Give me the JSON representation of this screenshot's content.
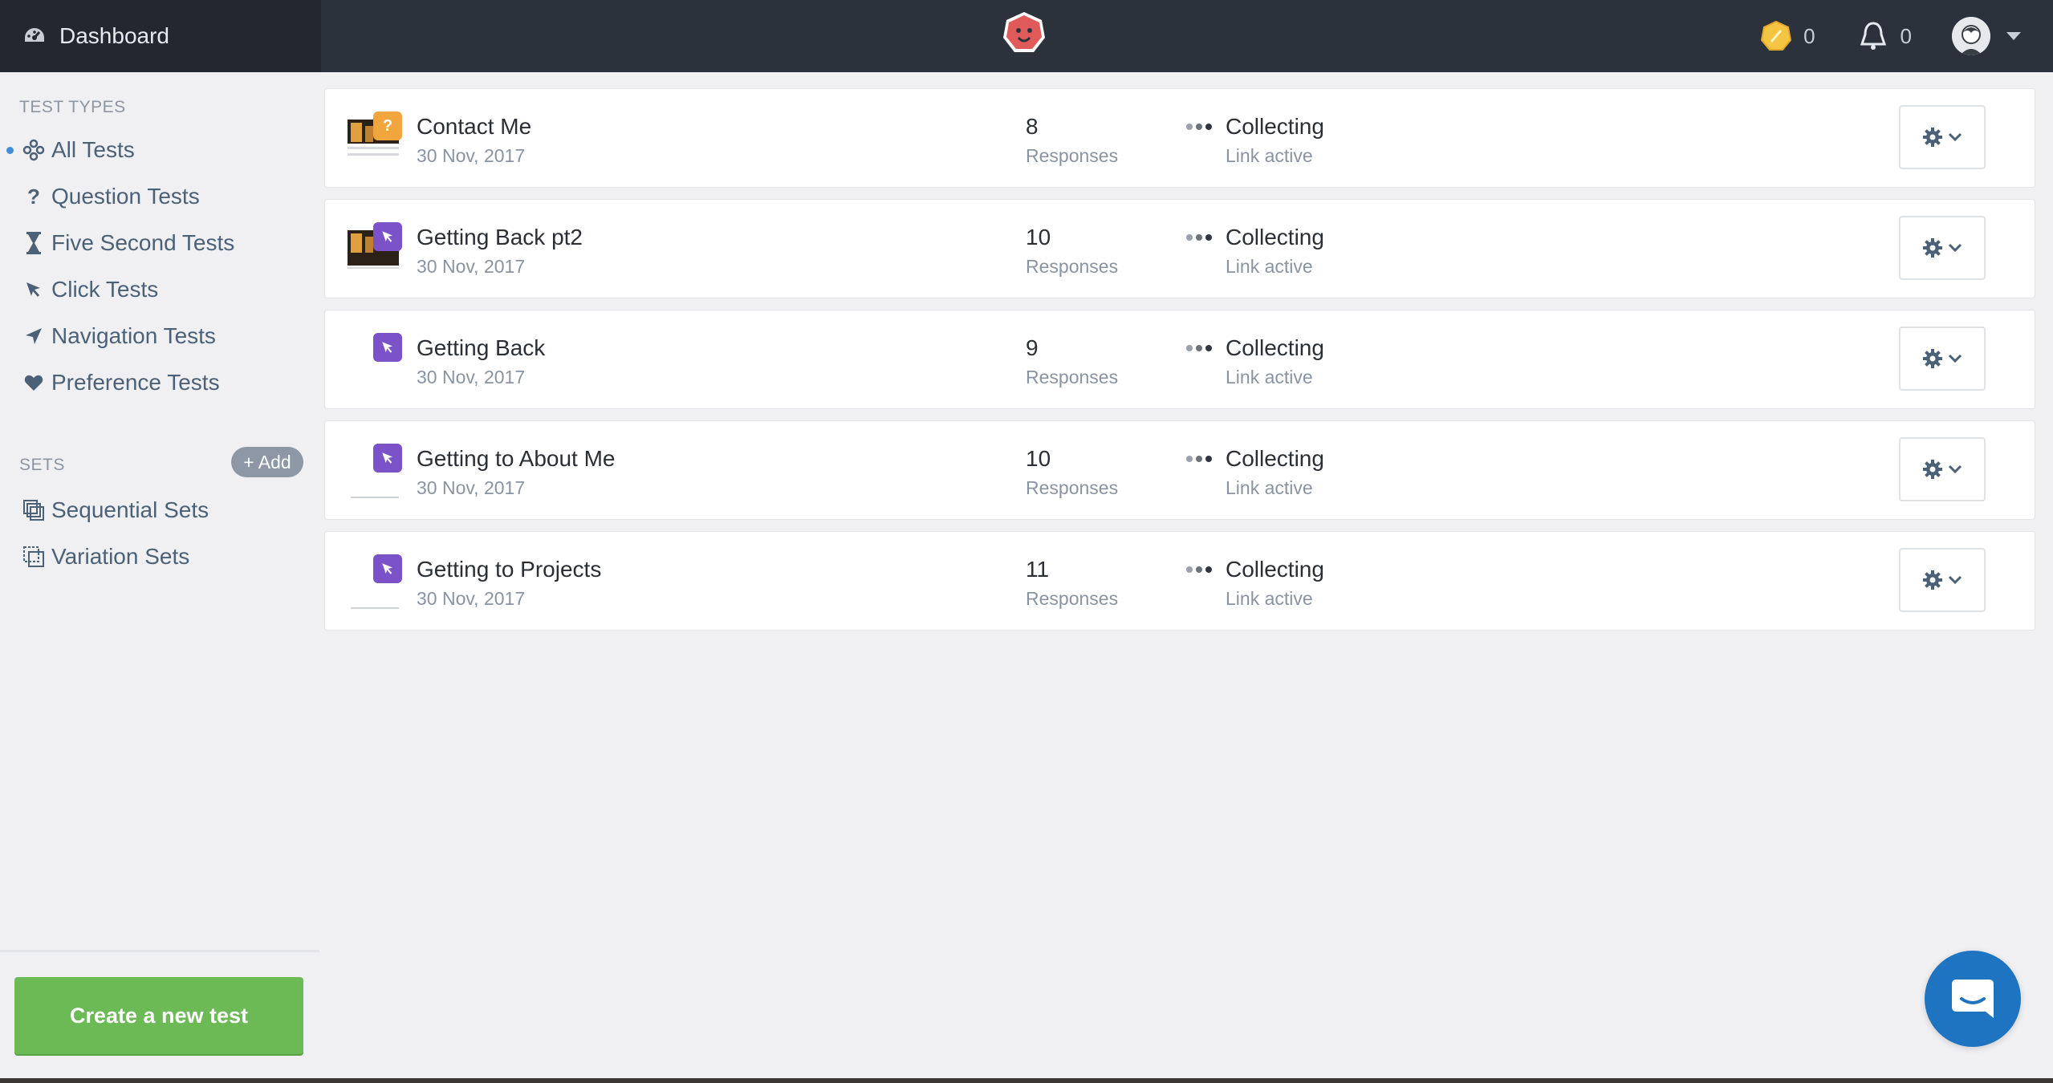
{
  "topbar": {
    "dashboard_label": "Dashboard",
    "credits_count": "0",
    "notifications_count": "0",
    "logo_color": "#e05a5a"
  },
  "sidebar": {
    "test_types_title": "TEST TYPES",
    "test_types": [
      {
        "label": "All Tests",
        "icon": "all-tests-icon",
        "active": true
      },
      {
        "label": "Question Tests",
        "icon": "question-icon"
      },
      {
        "label": "Five Second Tests",
        "icon": "hourglass-icon"
      },
      {
        "label": "Click Tests",
        "icon": "cursor-icon"
      },
      {
        "label": "Navigation Tests",
        "icon": "navigation-arrow-icon"
      },
      {
        "label": "Preference Tests",
        "icon": "heart-icon"
      }
    ],
    "sets_title": "SETS",
    "add_label": "+ Add",
    "sets": [
      {
        "label": "Sequential Sets",
        "icon": "sequential-sets-icon"
      },
      {
        "label": "Variation Sets",
        "icon": "variation-sets-icon"
      }
    ],
    "create_button_label": "Create a new test"
  },
  "tests": [
    {
      "name": "Contact Me",
      "date": "30 Nov, 2017",
      "responses": "8",
      "responses_label": "Responses",
      "status": "Collecting",
      "status_sub": "Link active",
      "type": "question"
    },
    {
      "name": "Getting Back pt2",
      "date": "30 Nov, 2017",
      "responses": "10",
      "responses_label": "Responses",
      "status": "Collecting",
      "status_sub": "Link active",
      "type": "click"
    },
    {
      "name": "Getting Back",
      "date": "30 Nov, 2017",
      "responses": "9",
      "responses_label": "Responses",
      "status": "Collecting",
      "status_sub": "Link active",
      "type": "click"
    },
    {
      "name": "Getting to About Me",
      "date": "30 Nov, 2017",
      "responses": "10",
      "responses_label": "Responses",
      "status": "Collecting",
      "status_sub": "Link active",
      "type": "click"
    },
    {
      "name": "Getting to Projects",
      "date": "30 Nov, 2017",
      "responses": "11",
      "responses_label": "Responses",
      "status": "Collecting",
      "status_sub": "Link active",
      "type": "click"
    }
  ],
  "colors": {
    "accent": "#3f8fd8",
    "create_button": "#6cba55",
    "question_badge": "#f0a53e",
    "click_badge": "#7b52c7",
    "chat_button": "#1f74c2"
  }
}
